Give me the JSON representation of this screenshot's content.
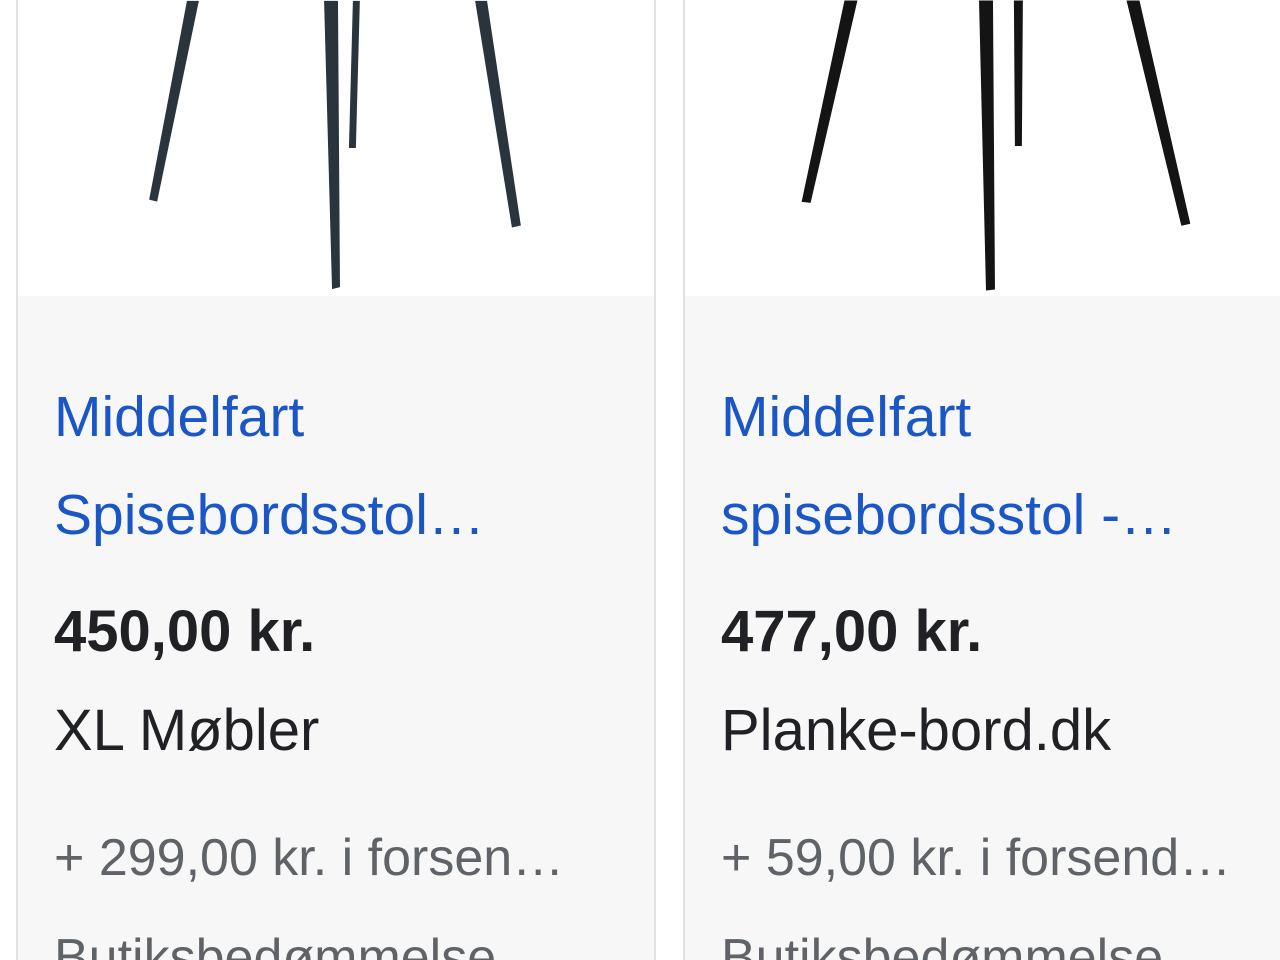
{
  "products": [
    {
      "title_line1": "Middelfart",
      "title_line2": "Spisebordsstol…",
      "price": "450,00 kr.",
      "store": "XL Møbler",
      "shipping": "+ 299,00 kr. i forsen…",
      "rating_label": "Butiksbedømmelse"
    },
    {
      "title_line1": "Middelfart",
      "title_line2": "spisebordsstol -…",
      "price": "477,00 kr.",
      "store": "Planke-bord.dk",
      "shipping": "+ 59,00 kr. i forsend…",
      "rating_label": "Butiksbedømmelse"
    }
  ],
  "colors": {
    "title_link": "#1a56c6",
    "price_text": "#202124",
    "secondary_text": "#5f6368",
    "card_background": "#f7f7f7",
    "chair_leg_1": "#2a343c",
    "chair_leg_2": "#141414"
  },
  "icons": [
    "chair-product-image",
    "chair-product-image"
  ]
}
